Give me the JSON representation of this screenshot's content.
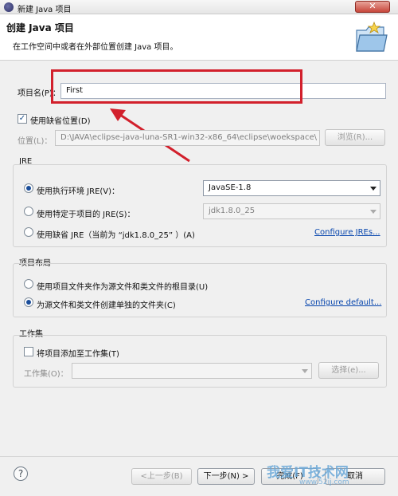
{
  "window": {
    "title": "新建 Java 项目",
    "close_glyph": "✕"
  },
  "header": {
    "title": "创建 Java 项目",
    "description": "在工作空间中或者在外部位置创建 Java 项目。"
  },
  "project": {
    "name_label": "项目名(P)：",
    "name_value": "First"
  },
  "location": {
    "use_default_label": "使用缺省位置(D)",
    "use_default_checked": true,
    "location_label": "位置(L)：",
    "location_value": "D:\\JAVA\\eclipse-java-luna-SR1-win32-x86_64\\eclipse\\woekspace\\",
    "browse_label": "浏览(R)..."
  },
  "jre": {
    "group_title": "JRE",
    "option_env_label": "使用执行环境 JRE(V)：",
    "option_env_value": "JavaSE-1.8",
    "option_specific_label": "使用特定于项目的 JRE(S)：",
    "option_specific_value": "jdk1.8.0_25",
    "option_default_label": "使用缺省 JRE（当前为 “jdk1.8.0_25” ）(A)",
    "configure_link": "Configure JREs..."
  },
  "layout": {
    "group_title": "项目布局",
    "option_root_label": "使用项目文件夹作为源文件和类文件的根目录(U)",
    "option_separate_label": "为源文件和类文件创建单独的文件夹(C)",
    "configure_link": "Configure default..."
  },
  "workingset": {
    "group_title": "工作集",
    "add_label": "将项目添加至工作集(T)",
    "set_label": "工作集(O)：",
    "set_value": "",
    "select_label": "选择(e)..."
  },
  "footer": {
    "help_glyph": "?",
    "back_label": "<上一步(B)",
    "next_label": "下一步(N) >",
    "finish_label": "完成(F)",
    "cancel_label": "取消"
  },
  "watermark": {
    "text": "我爱IT技术网",
    "sub": "www.52ij.com"
  },
  "colors": {
    "annotation_red": "#d2202c",
    "link_blue": "#0645ad",
    "radio_fill": "#1a4d9a"
  }
}
